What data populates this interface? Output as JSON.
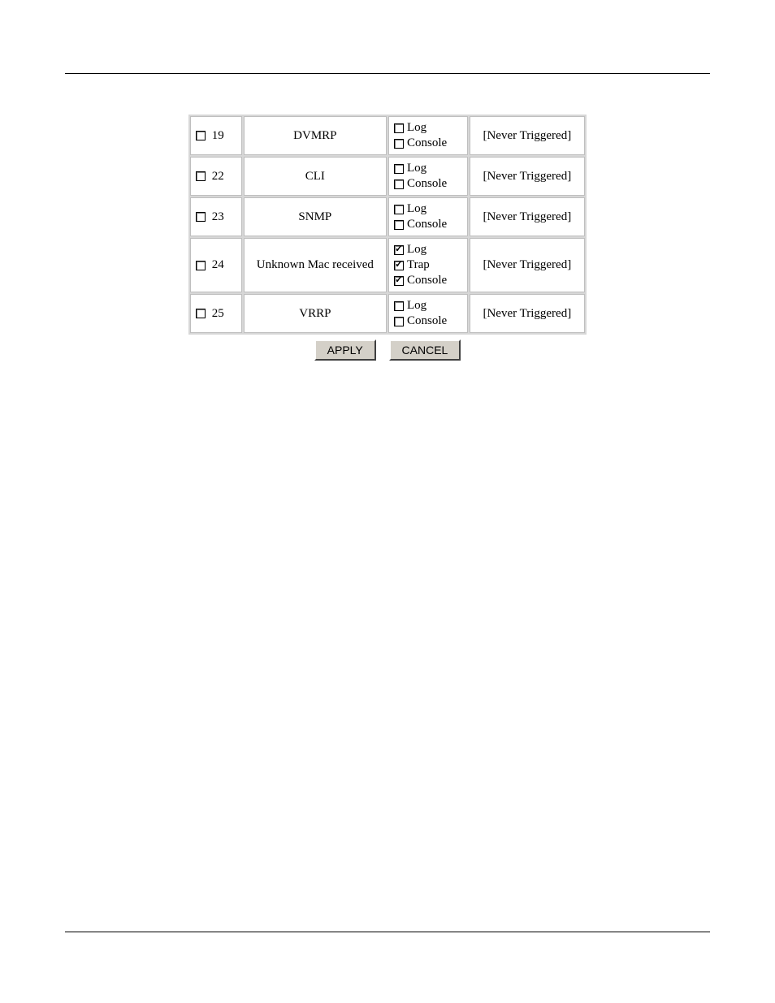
{
  "events": [
    {
      "id": "19",
      "name": "DVMRP",
      "options": [
        {
          "key": "log",
          "label": "Log",
          "checked": false
        },
        {
          "key": "console",
          "label": "Console",
          "checked": false
        }
      ],
      "status": "[Never Triggered]"
    },
    {
      "id": "22",
      "name": "CLI",
      "options": [
        {
          "key": "log",
          "label": "Log",
          "checked": false
        },
        {
          "key": "console",
          "label": "Console",
          "checked": false
        }
      ],
      "status": "[Never Triggered]"
    },
    {
      "id": "23",
      "name": "SNMP",
      "options": [
        {
          "key": "log",
          "label": "Log",
          "checked": false
        },
        {
          "key": "console",
          "label": "Console",
          "checked": false
        }
      ],
      "status": "[Never Triggered]"
    },
    {
      "id": "24",
      "name": "Unknown Mac received",
      "options": [
        {
          "key": "log",
          "label": "Log",
          "checked": true
        },
        {
          "key": "trap",
          "label": "Trap",
          "checked": true
        },
        {
          "key": "console",
          "label": "Console",
          "checked": true
        }
      ],
      "status": "[Never Triggered]"
    },
    {
      "id": "25",
      "name": "VRRP",
      "options": [
        {
          "key": "log",
          "label": "Log",
          "checked": false
        },
        {
          "key": "console",
          "label": "Console",
          "checked": false
        }
      ],
      "status": "[Never Triggered]"
    }
  ],
  "buttons": {
    "apply": "APPLY",
    "cancel": "CANCEL"
  }
}
